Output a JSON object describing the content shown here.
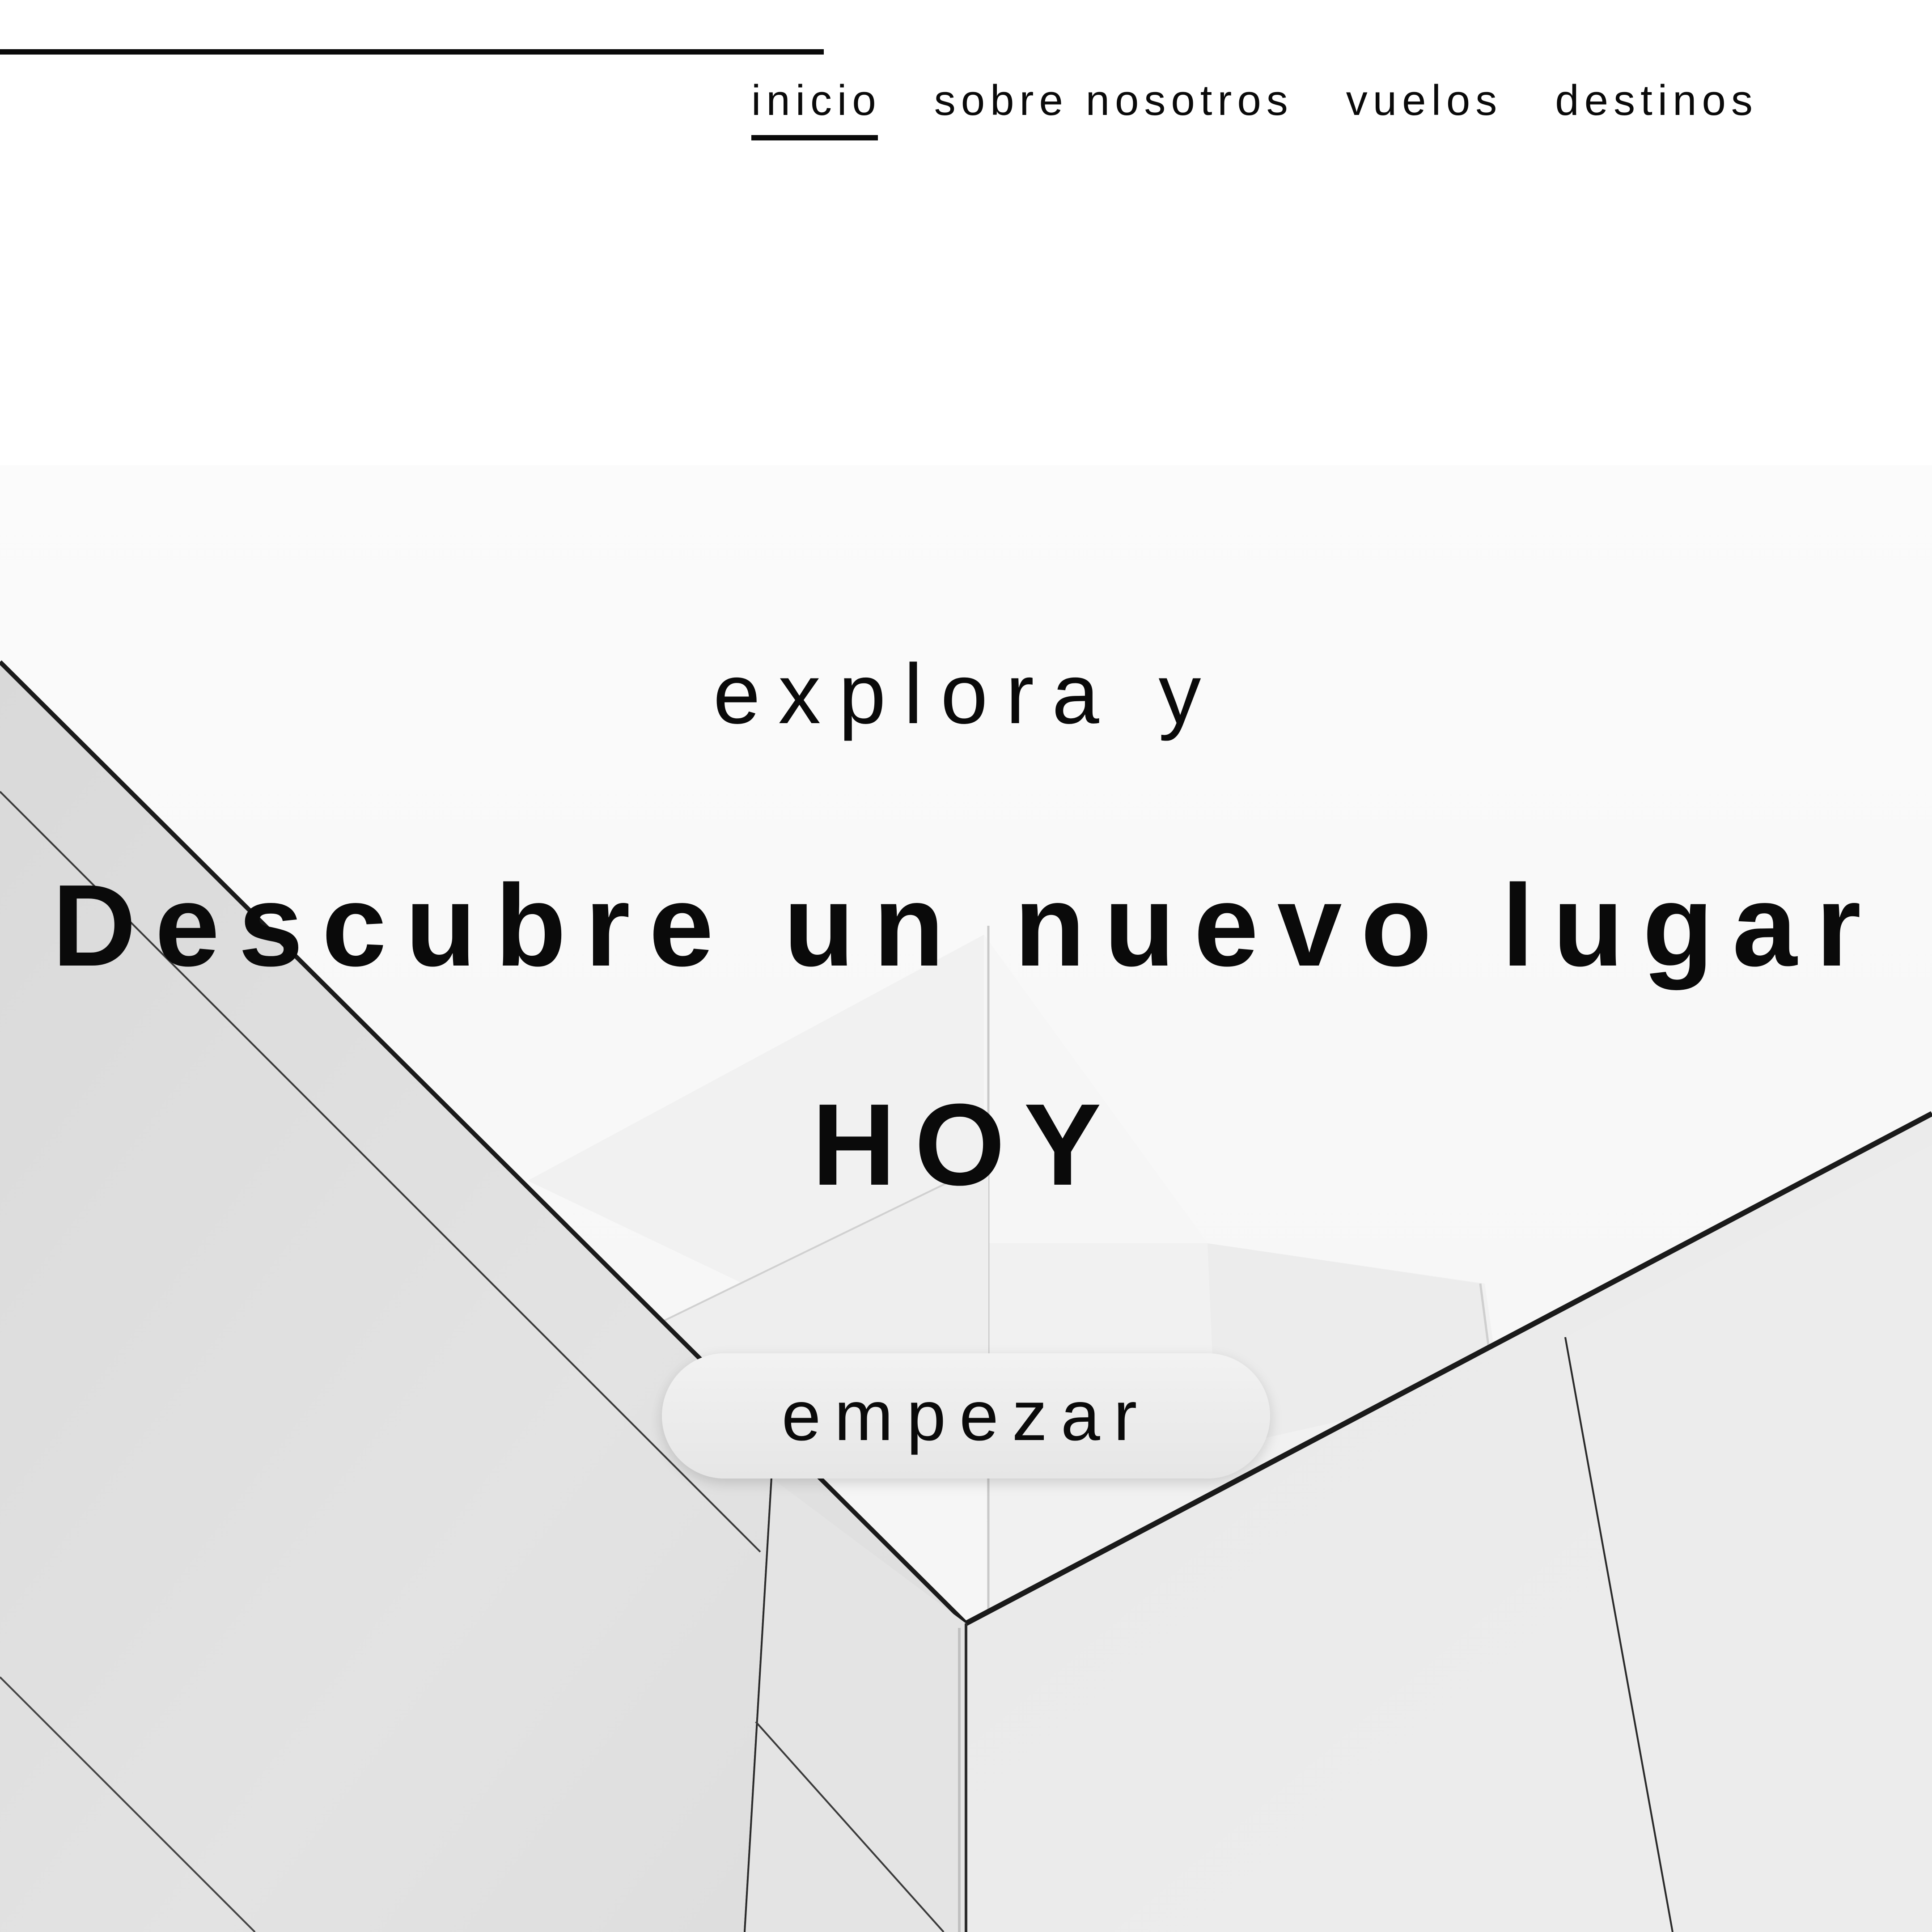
{
  "nav": {
    "items": [
      {
        "label": "inicio",
        "active": true
      },
      {
        "label": "sobre nosotros",
        "active": false
      },
      {
        "label": "vuelos",
        "active": false
      },
      {
        "label": "destinos",
        "active": false
      }
    ]
  },
  "hero": {
    "tagline": "explora y",
    "headline_line1": "Descubre un nuevo lugar",
    "headline_line2": "HOY",
    "cta_label": "empezar"
  },
  "colors": {
    "text": "#0a0a0a",
    "background": "#ffffff",
    "cta_background": "#ececec"
  }
}
